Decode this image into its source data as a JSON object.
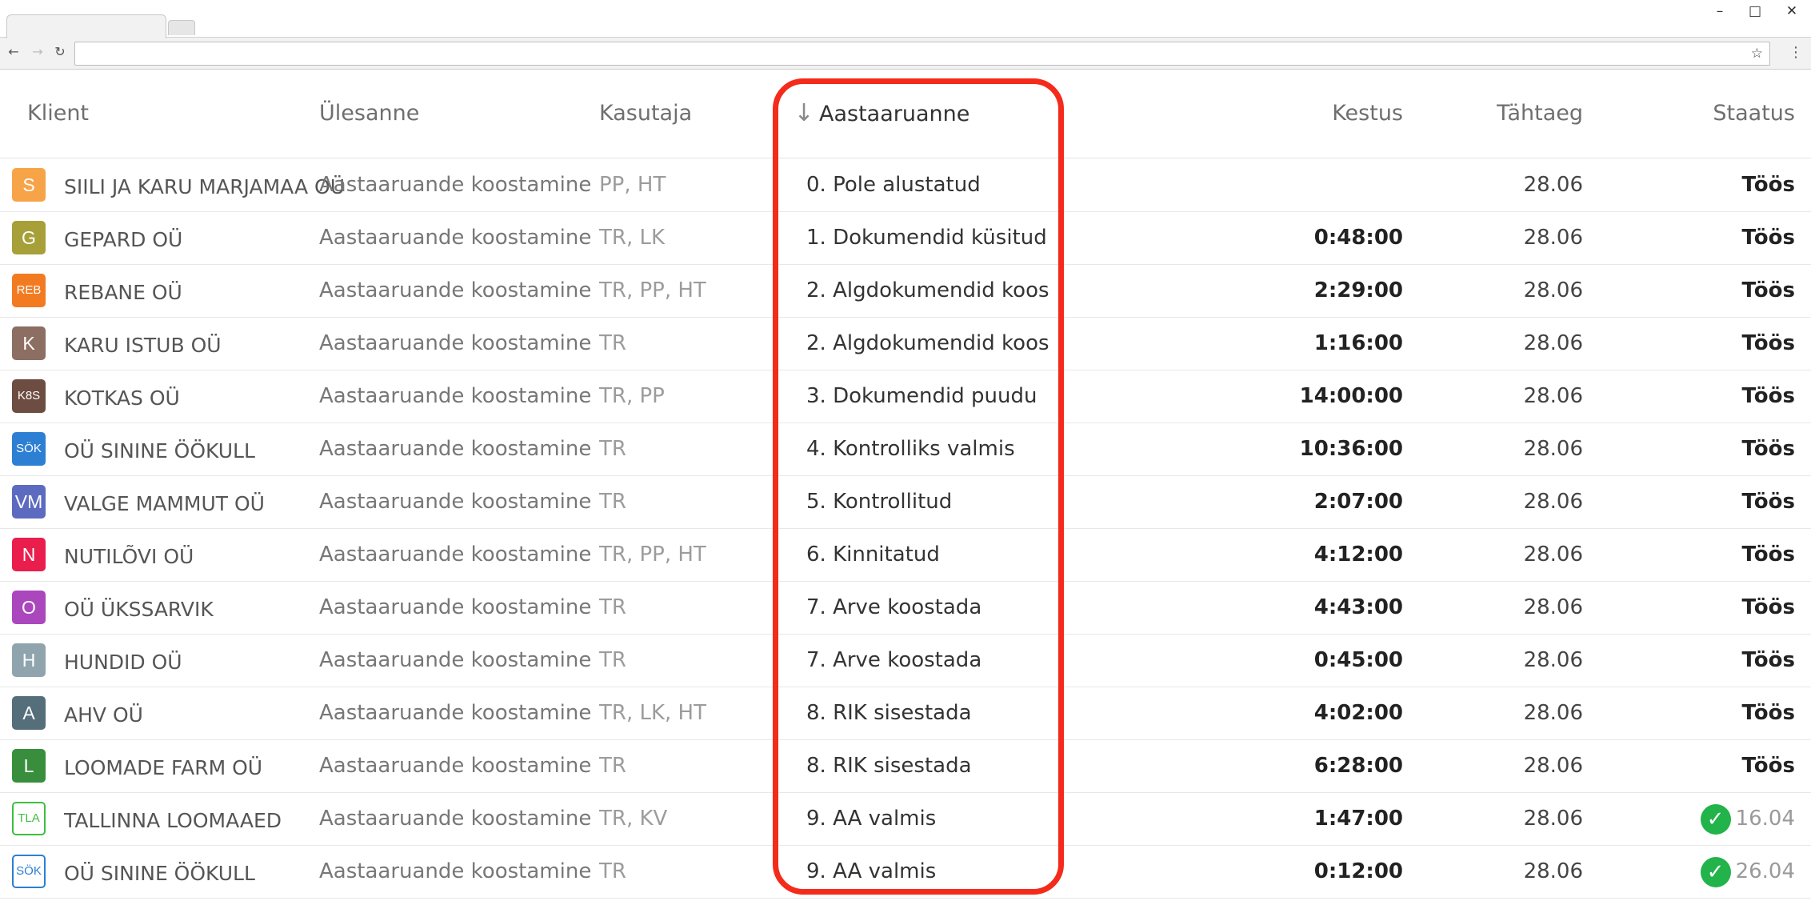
{
  "browser": {
    "address_value": "",
    "icons": [
      "back-icon",
      "forward-icon",
      "reload-icon",
      "star-icon",
      "menu-kebab-icon",
      "minimize-icon",
      "maximize-icon",
      "close-icon"
    ]
  },
  "table": {
    "headers": {
      "client": "Klient",
      "task": "Ülesanne",
      "user": "Kasutaja",
      "report": "Aastaaruanne",
      "duration": "Kestus",
      "due": "Tähtaeg",
      "status": "Staatus"
    },
    "sorted_column": "report",
    "rows": [
      {
        "initials": "S",
        "color": "#f7a449",
        "client": "SIILI JA KARU MARJAMAA OÜ",
        "task": "Aastaaruande koostamine",
        "user": "PP, HT",
        "status": "0. Pole alustatud",
        "duration": "",
        "due": "28.06",
        "state": "Töös"
      },
      {
        "initials": "G",
        "color": "#a7a039",
        "client": "GEPARD OÜ",
        "task": "Aastaaruande koostamine",
        "user": "TR, LK",
        "status": "1. Dokumendid küsitud",
        "duration": "0:48:00",
        "due": "28.06",
        "state": "Töös"
      },
      {
        "initials": "REB",
        "color": "#f27b22",
        "client": "REBANE OÜ",
        "task": "Aastaaruande koostamine",
        "user": "TR, PP, HT",
        "status": "2. Algdokumendid koos",
        "duration": "2:29:00",
        "due": "28.06",
        "state": "Töös"
      },
      {
        "initials": "K",
        "color": "#8d6e63",
        "client": "KARU ISTUB OÜ",
        "task": "Aastaaruande koostamine",
        "user": "TR",
        "status": "2. Algdokumendid koos",
        "duration": "1:16:00",
        "due": "28.06",
        "state": "Töös"
      },
      {
        "initials": "K8S",
        "color": "#6d4c41",
        "client": "KOTKAS OÜ",
        "task": "Aastaaruande koostamine",
        "user": "TR, PP",
        "status": "3. Dokumendid puudu",
        "duration": "14:00:00",
        "due": "28.06",
        "state": "Töös"
      },
      {
        "initials": "SÖK",
        "color": "#2d7fd3",
        "client": "OÜ SININE ÖÖKULL",
        "task": "Aastaaruande koostamine",
        "user": "TR",
        "status": "4. Kontrolliks valmis",
        "duration": "10:36:00",
        "due": "28.06",
        "state": "Töös"
      },
      {
        "initials": "VM",
        "color": "#5c6bc0",
        "client": "VALGE MAMMUT OÜ",
        "task": "Aastaaruande koostamine",
        "user": "TR",
        "status": "5. Kontrollitud",
        "duration": "2:07:00",
        "due": "28.06",
        "state": "Töös"
      },
      {
        "initials": "N",
        "color": "#e91e4d",
        "client": "NUTILÕVI OÜ",
        "task": "Aastaaruande koostamine",
        "user": "TR, PP, HT",
        "status": "6. Kinnitatud",
        "duration": "4:12:00",
        "due": "28.06",
        "state": "Töös"
      },
      {
        "initials": "O",
        "color": "#ab47bc",
        "client": "OÜ ÜKSSARVIK",
        "task": "Aastaaruande koostamine",
        "user": "TR",
        "status": "7. Arve koostada",
        "duration": "4:43:00",
        "due": "28.06",
        "state": "Töös"
      },
      {
        "initials": "H",
        "color": "#90a4ae",
        "client": "HUNDID OÜ",
        "task": "Aastaaruande koostamine",
        "user": "TR",
        "status": "7. Arve koostada",
        "duration": "0:45:00",
        "due": "28.06",
        "state": "Töös"
      },
      {
        "initials": "A",
        "color": "#546e7a",
        "client": "AHV OÜ",
        "task": "Aastaaruande koostamine",
        "user": "TR, LK, HT",
        "status": "8. RIK sisestada",
        "duration": "4:02:00",
        "due": "28.06",
        "state": "Töös"
      },
      {
        "initials": "L",
        "color": "#388e3c",
        "client": "LOOMADE FARM OÜ",
        "task": "Aastaaruande koostamine",
        "user": "TR",
        "status": "8. RIK sisestada",
        "duration": "6:28:00",
        "due": "28.06",
        "state": "Töös"
      },
      {
        "initials": "TLA",
        "color": "#3fbf3f",
        "outline": true,
        "client": "TALLINNA LOOMAAED",
        "task": "Aastaaruande koostamine",
        "user": "TR, KV",
        "status": "9. AA valmis",
        "duration": "1:47:00",
        "due": "28.06",
        "state": "16.04",
        "done": true
      },
      {
        "initials": "SÖK",
        "color": "#2d7fd3",
        "outline": true,
        "client": "OÜ SININE ÖÖKULL",
        "task": "Aastaaruande koostamine",
        "user": "TR",
        "status": "9. AA valmis",
        "duration": "0:12:00",
        "due": "28.06",
        "state": "26.04",
        "done": true
      }
    ]
  },
  "highlight_color": "#f42b1a"
}
